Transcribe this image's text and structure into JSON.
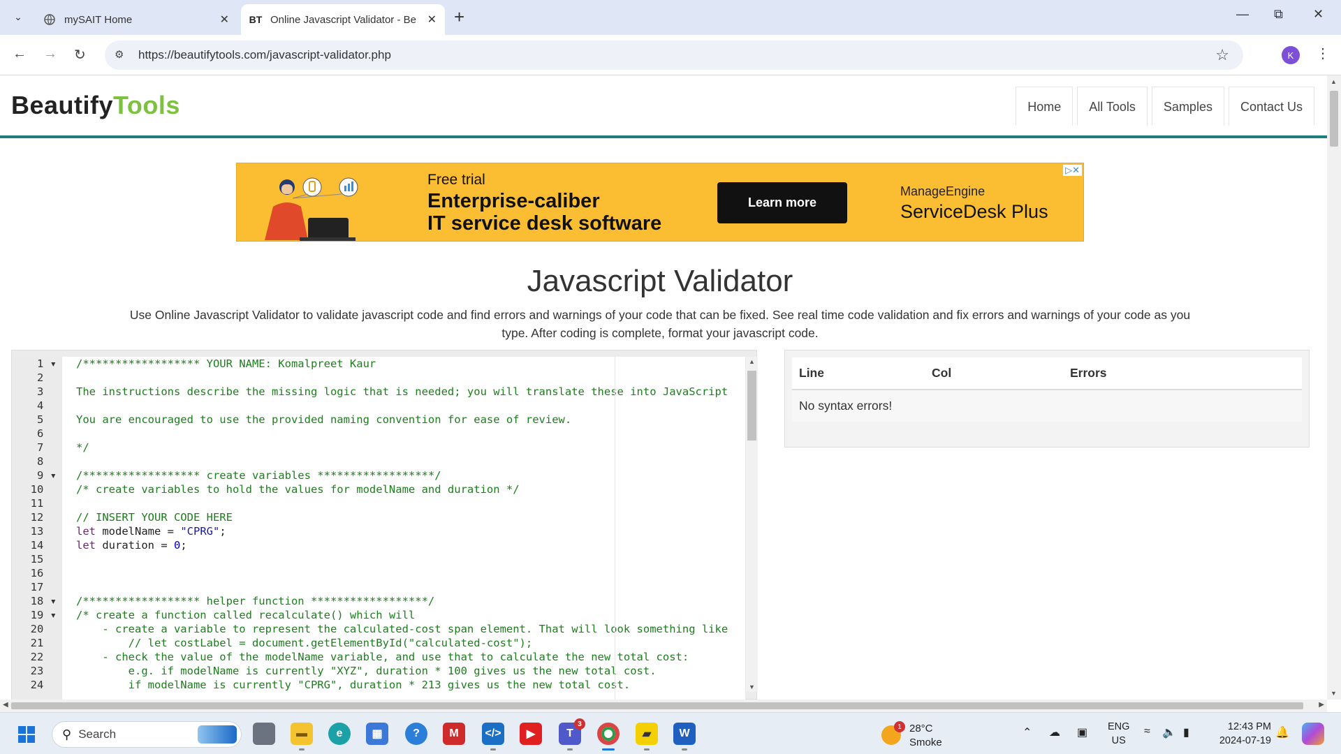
{
  "browser": {
    "tabs": [
      {
        "title": "mySAIT Home",
        "icon": "globe-icon",
        "active": false
      },
      {
        "title": "Online Javascript Validator - Be",
        "icon_text": "BT",
        "active": true
      }
    ],
    "url": "https://beautifytools.com/javascript-validator.php",
    "profile_initial": "K"
  },
  "site": {
    "logo_part1": "Beautify",
    "logo_part2": "Tools",
    "nav": [
      "Home",
      "All Tools",
      "Samples",
      "Contact Us"
    ]
  },
  "ad": {
    "tagline": "Free trial",
    "headline_line1": "Enterprise-caliber",
    "headline_line2": "IT service desk software",
    "cta": "Learn more",
    "brand_small": "ManageEngine",
    "brand_product": "ServiceDesk Plus",
    "adchoices": "▷✕",
    "colors": {
      "background": "#fbbe33",
      "cta": "#111111"
    }
  },
  "main": {
    "title": "Javascript Validator",
    "description": "Use Online Javascript Validator to validate javascript code and find errors and warnings of your code that can be fixed. See real time code validation and fix errors and warnings of your code as you type. After coding is complete, format your javascript code."
  },
  "editor": {
    "line_numbers": [
      "1",
      "2",
      "3",
      "4",
      "5",
      "6",
      "7",
      "8",
      "9",
      "10",
      "11",
      "12",
      "13",
      "14",
      "15",
      "16",
      "17",
      "18",
      "19",
      "20",
      "21",
      "22",
      "23",
      "24"
    ],
    "fold_lines": [
      "1",
      "9",
      "18",
      "19"
    ],
    "lines": [
      "/****************** YOUR NAME: Komalpreet Kaur",
      "",
      "The instructions describe the missing logic that is needed; you will translate these into JavaScript",
      "",
      "You are encouraged to use the provided naming convention for ease of review.",
      "",
      "*/",
      "",
      "/****************** create variables ******************/",
      "/* create variables to hold the values for modelName and duration */",
      "",
      "// INSERT YOUR CODE HERE",
      "",
      "",
      "",
      "",
      "",
      "/****************** helper function ******************/",
      "/* create a function called recalculate() which will",
      "    - create a variable to represent the calculated-cost span element. That will look something like",
      "        // let costLabel = document.getElementById(\"calculated-cost\");",
      "    - check the value of the modelName variable, and use that to calculate the new total cost:",
      "        e.g. if modelName is currently \"XYZ\", duration * 100 gives us the new total cost.",
      "        if modelName is currently \"CPRG\", duration * 213 gives us the new total cost."
    ],
    "line13": {
      "kw": "let",
      "name": " modelName = ",
      "value": "\"CPRG\"",
      "end": ";"
    },
    "line14": {
      "kw": "let",
      "name": " duration = ",
      "value": "0",
      "end": ";"
    }
  },
  "results": {
    "headers": [
      "Line",
      "Col",
      "Errors"
    ],
    "message": "No syntax errors!"
  },
  "taskbar": {
    "search_label": "Search",
    "weather_temp": "28°C",
    "weather_cond": "Smoke",
    "weather_badge": "1",
    "teams_badge": "3",
    "lang_line1": "ENG",
    "lang_line2": "US",
    "time": "12:43 PM",
    "date": "2024-07-19"
  }
}
